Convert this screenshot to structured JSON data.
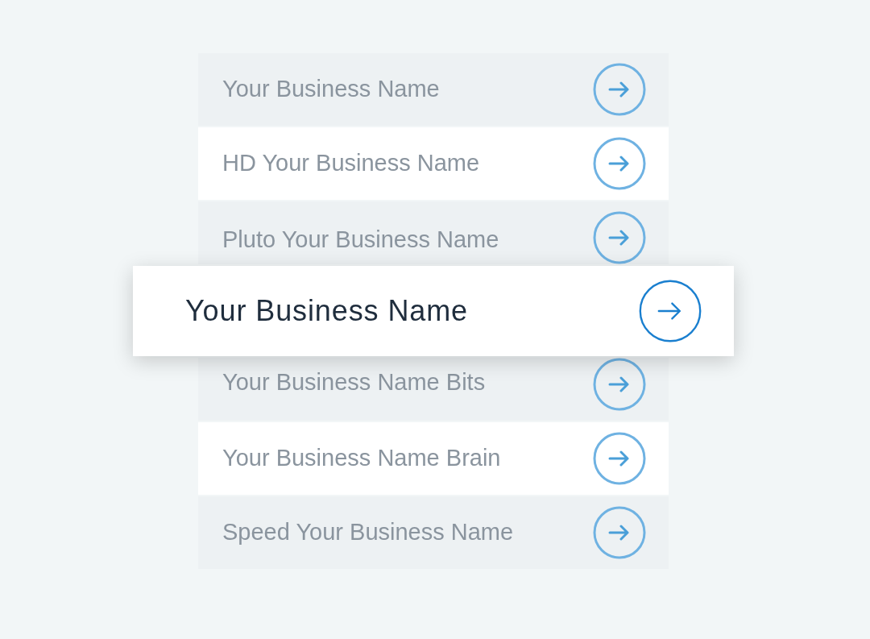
{
  "items": [
    {
      "text": "Your Business Name",
      "selected": false,
      "shaded": true
    },
    {
      "text": "HD Your Business Name",
      "selected": false,
      "shaded": false
    },
    {
      "text": "Pluto Your Business Name",
      "selected": false,
      "shaded": true
    },
    {
      "text": "Your Business Name",
      "selected": true
    },
    {
      "text": "Your Business Name Bits",
      "selected": false,
      "shaded": true
    },
    {
      "text": "Your Business Name Brain",
      "selected": false,
      "shaded": false
    },
    {
      "text": "Speed Your Business Name",
      "selected": false,
      "shaded": true
    }
  ]
}
